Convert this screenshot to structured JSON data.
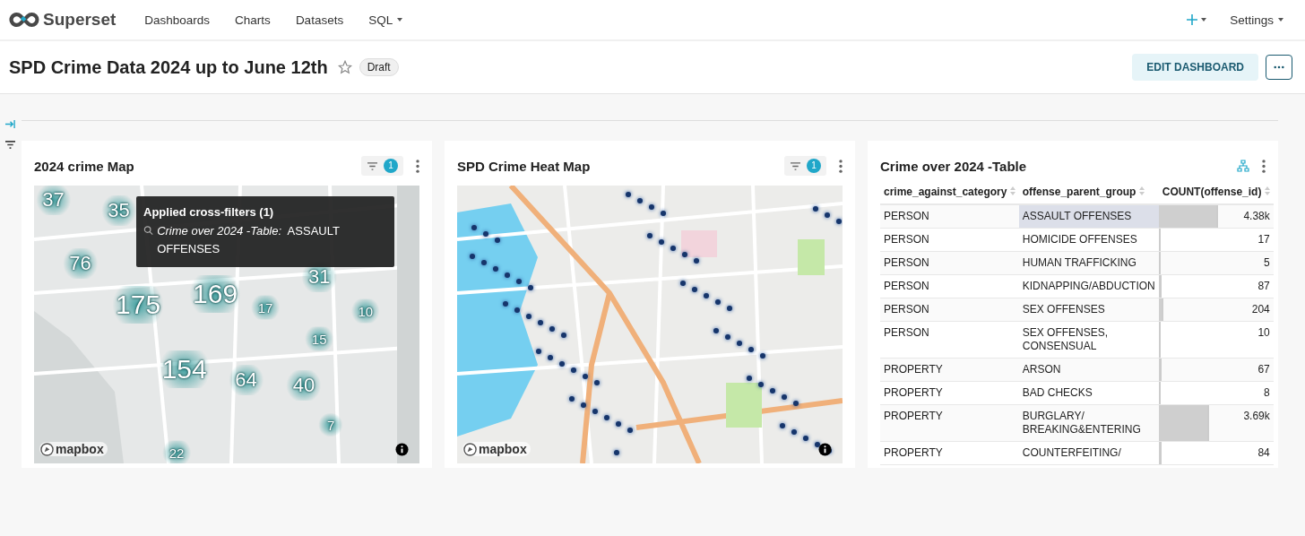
{
  "nav": {
    "brand": "Superset",
    "items": [
      {
        "label": "Dashboards",
        "dropdown": false
      },
      {
        "label": "Charts",
        "dropdown": false
      },
      {
        "label": "Datasets",
        "dropdown": false
      },
      {
        "label": "SQL",
        "dropdown": true
      }
    ],
    "settings": "Settings"
  },
  "header": {
    "title": "SPD Crime Data 2024 up to June 12th",
    "starred": false,
    "badge": "Draft",
    "edit_button": "EDIT DASHBOARD"
  },
  "charts": [
    {
      "kind": "cluster_map",
      "title": "2024 crime Map",
      "filter_count": "1",
      "attribution": "mapbox",
      "clusters": [
        "37",
        "35",
        "76",
        "175",
        "169",
        "31",
        "17",
        "10",
        "15",
        "154",
        "64",
        "40",
        "7",
        "22"
      ],
      "tooltip": {
        "title": "Applied cross-filters (1)",
        "source": "Crime over 2024 -Table:",
        "value": "ASSAULT OFFENSES"
      }
    },
    {
      "kind": "heat_map",
      "title": "SPD Crime Heat Map",
      "filter_count": "1",
      "attribution": "mapbox"
    },
    {
      "kind": "table",
      "title": "Crime over 2024 -Table",
      "columns": [
        "crime_against_category",
        "offense_parent_group",
        "COUNT(offense_id)"
      ],
      "rows": [
        {
          "category": "PERSON",
          "group": "ASSAULT OFFENSES",
          "count": "4.38k",
          "level": 0.5,
          "selected": true
        },
        {
          "category": "PERSON",
          "group": "HOMICIDE OFFENSES",
          "count": "17",
          "level": 0.002,
          "selected": false
        },
        {
          "category": "PERSON",
          "group": "HUMAN TRAFFICKING",
          "count": "5",
          "level": 0.001,
          "selected": false
        },
        {
          "category": "PERSON",
          "group": "KIDNAPPING/ABDUCTION",
          "count": "87",
          "level": 0.01,
          "selected": false
        },
        {
          "category": "PERSON",
          "group": "SEX OFFENSES",
          "count": "204",
          "level": 0.023,
          "selected": false
        },
        {
          "category": "PERSON",
          "group": "SEX OFFENSES, CONSENSUAL",
          "count": "10",
          "level": 0.001,
          "selected": false
        },
        {
          "category": "PROPERTY",
          "group": "ARSON",
          "count": "67",
          "level": 0.008,
          "selected": false
        },
        {
          "category": "PROPERTY",
          "group": "BAD CHECKS",
          "count": "8",
          "level": 0.001,
          "selected": false
        },
        {
          "category": "PROPERTY",
          "group": "BURGLARY/ BREAKING&ENTERING",
          "count": "3.69k",
          "level": 0.42,
          "selected": false
        },
        {
          "category": "PROPERTY",
          "group": "COUNTERFEITING/",
          "count": "84",
          "level": 0.01,
          "selected": false
        }
      ]
    }
  ]
}
